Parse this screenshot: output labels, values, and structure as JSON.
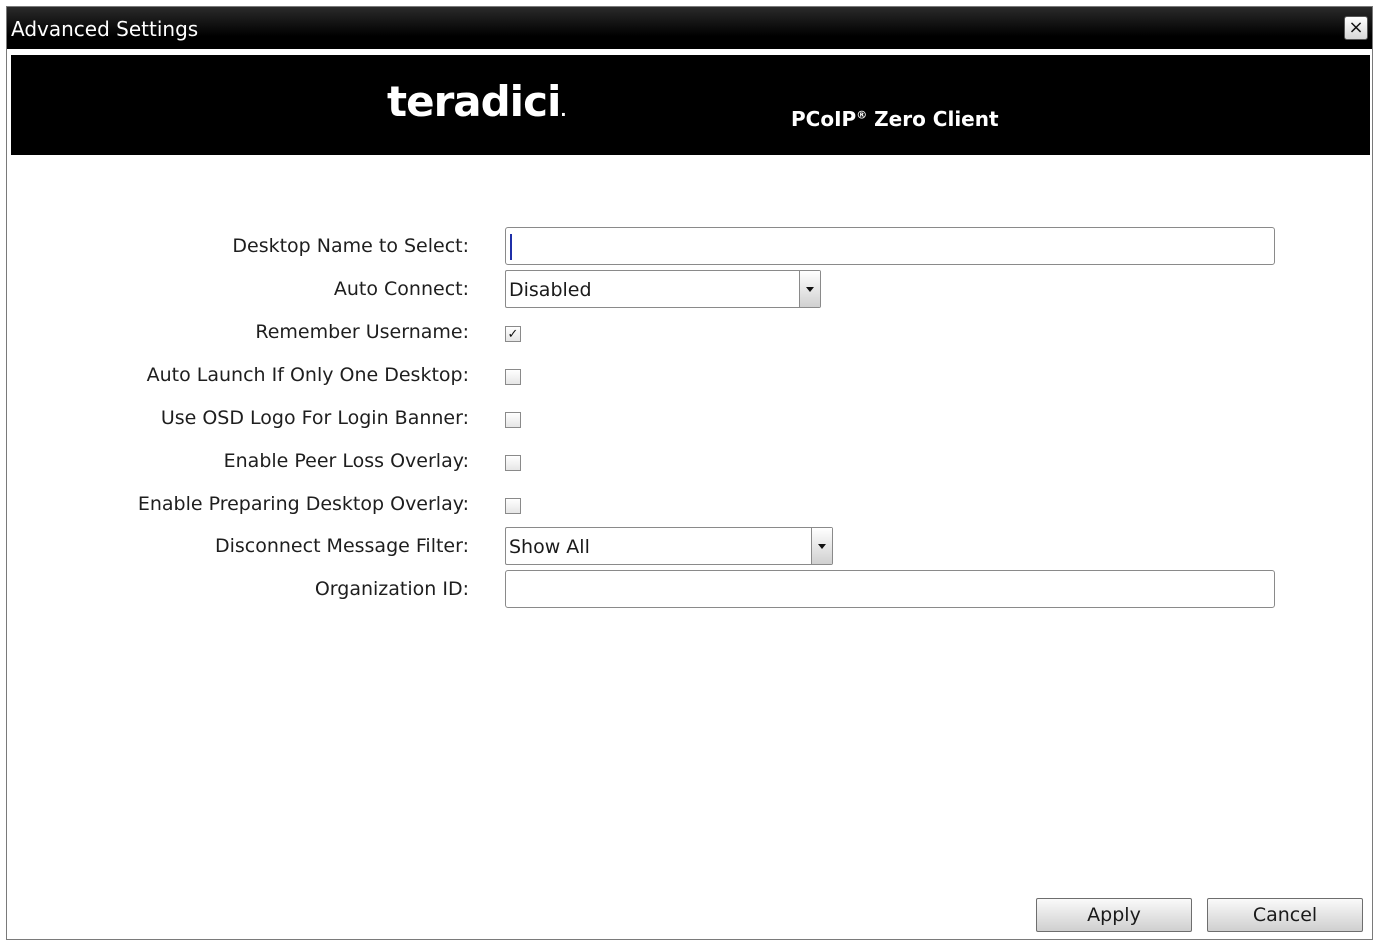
{
  "window": {
    "title": "Advanced Settings",
    "close_label": "×"
  },
  "banner": {
    "logo": "teradici",
    "logo_dot": ".",
    "product": "PCoIP",
    "product_reg": "®",
    "product_suffix": " Zero Client"
  },
  "form": {
    "desktop_name": {
      "label": "Desktop Name to Select:",
      "value": ""
    },
    "auto_connect": {
      "label": "Auto Connect:",
      "value": "Disabled"
    },
    "remember_username": {
      "label": "Remember Username:",
      "checked": true,
      "mark": "✓"
    },
    "auto_launch": {
      "label": "Auto Launch If Only One Desktop:",
      "checked": false
    },
    "osd_logo": {
      "label": "Use OSD Logo For Login Banner:",
      "checked": false
    },
    "peer_loss_overlay": {
      "label": "Enable Peer Loss Overlay:",
      "checked": false
    },
    "preparing_overlay": {
      "label": "Enable Preparing Desktop Overlay:",
      "checked": false
    },
    "disconnect_filter": {
      "label": "Disconnect Message Filter:",
      "value": "Show All"
    },
    "organization_id": {
      "label": "Organization ID:",
      "value": ""
    }
  },
  "buttons": {
    "apply": "Apply",
    "cancel": "Cancel"
  }
}
